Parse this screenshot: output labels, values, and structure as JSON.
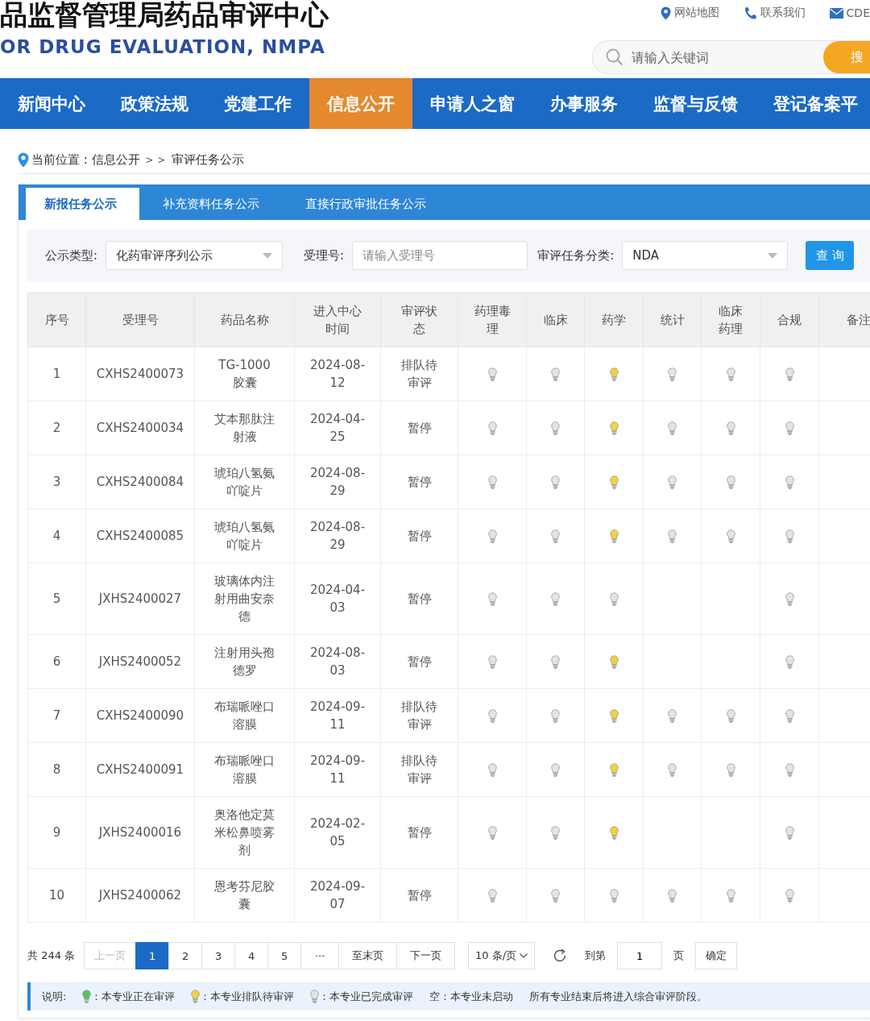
{
  "header": {
    "title": "品监督管理局药品审评中心",
    "subtitle": "OR DRUG EVALUATION, NMPA",
    "links": [
      {
        "kind": "map",
        "label": "网站地图"
      },
      {
        "kind": "phone",
        "label": "联系我们"
      },
      {
        "kind": "mail",
        "label": "CDE"
      }
    ],
    "search": {
      "placeholder": "请输入关键词",
      "button": "搜"
    }
  },
  "nav": [
    {
      "label": "新闻中心",
      "selected": false
    },
    {
      "label": "政策法规",
      "selected": false
    },
    {
      "label": "党建工作",
      "selected": false
    },
    {
      "label": "信息公开",
      "selected": true
    },
    {
      "label": "申请人之窗",
      "selected": false
    },
    {
      "label": "办事服务",
      "selected": false
    },
    {
      "label": "监督与反馈",
      "selected": false
    },
    {
      "label": "登记备案平",
      "selected": false
    }
  ],
  "breadcrumb": "当前位置 : 信息公开 ＞＞ 审评任务公示",
  "tabs": [
    {
      "label": "新报任务公示",
      "selected": true
    },
    {
      "label": "补充资料任务公示",
      "selected": false
    },
    {
      "label": "直接行政审批任务公示",
      "selected": false
    }
  ],
  "filters": {
    "type_label": "公示类型:",
    "type_value": "化药审评序列公示",
    "number_label": "受理号:",
    "number_placeholder": "请输入受理号",
    "category_label": "审评任务分类:",
    "category_value": "NDA",
    "query_button": "查 询"
  },
  "table": {
    "columns": [
      "序号",
      "受理号",
      "药品名称",
      "进入中心时间",
      "审评状态",
      "药理毒理",
      "临床",
      "药学",
      "统计",
      "临床药理",
      "合规",
      "备注"
    ],
    "rows": [
      {
        "no": "1",
        "number": "CXHS2400073",
        "name": "TG-1000胶囊",
        "date": "2024-08-12",
        "status": "排队待审评",
        "reviews": [
          {
            "kind": "done"
          },
          {
            "kind": "done"
          },
          {
            "kind": "queued"
          },
          {
            "kind": "done"
          },
          {
            "kind": "done"
          },
          {
            "kind": "done"
          }
        ]
      },
      {
        "no": "2",
        "number": "CXHS2400034",
        "name": "艾本那肽注射液",
        "date": "2024-04-25",
        "status": "暂停",
        "reviews": [
          {
            "kind": "done"
          },
          {
            "kind": "done"
          },
          {
            "kind": "queued"
          },
          {
            "kind": "done"
          },
          {
            "kind": "done"
          },
          {
            "kind": "done"
          }
        ]
      },
      {
        "no": "3",
        "number": "CXHS2400084",
        "name": "琥珀八氢氨吖啶片",
        "date": "2024-08-29",
        "status": "暂停",
        "reviews": [
          {
            "kind": "done"
          },
          {
            "kind": "done"
          },
          {
            "kind": "queued"
          },
          {
            "kind": "done"
          },
          {
            "kind": "done"
          },
          {
            "kind": "done"
          }
        ]
      },
      {
        "no": "4",
        "number": "CXHS2400085",
        "name": "琥珀八氢氨吖啶片",
        "date": "2024-08-29",
        "status": "暂停",
        "reviews": [
          {
            "kind": "done"
          },
          {
            "kind": "done"
          },
          {
            "kind": "queued"
          },
          {
            "kind": "done"
          },
          {
            "kind": "done"
          },
          {
            "kind": "done"
          }
        ]
      },
      {
        "no": "5",
        "number": "JXHS2400027",
        "name": "玻璃体内注射用曲安奈德",
        "date": "2024-04-03",
        "status": "暂停",
        "reviews": [
          {
            "kind": "done"
          },
          {
            "kind": "done"
          },
          {
            "kind": "done"
          },
          {
            "kind": "none"
          },
          {
            "kind": "none"
          },
          {
            "kind": "done"
          }
        ]
      },
      {
        "no": "6",
        "number": "JXHS2400052",
        "name": "注射用头孢德罗",
        "date": "2024-08-03",
        "status": "暂停",
        "reviews": [
          {
            "kind": "done"
          },
          {
            "kind": "done"
          },
          {
            "kind": "queued"
          },
          {
            "kind": "none"
          },
          {
            "kind": "none"
          },
          {
            "kind": "done"
          }
        ]
      },
      {
        "no": "7",
        "number": "CXHS2400090",
        "name": "布瑞哌唑口溶膜",
        "date": "2024-09-11",
        "status": "排队待审评",
        "reviews": [
          {
            "kind": "done"
          },
          {
            "kind": "done"
          },
          {
            "kind": "queued"
          },
          {
            "kind": "done"
          },
          {
            "kind": "done"
          },
          {
            "kind": "done"
          }
        ]
      },
      {
        "no": "8",
        "number": "CXHS2400091",
        "name": "布瑞哌唑口溶膜",
        "date": "2024-09-11",
        "status": "排队待审评",
        "reviews": [
          {
            "kind": "done"
          },
          {
            "kind": "done"
          },
          {
            "kind": "queued"
          },
          {
            "kind": "done"
          },
          {
            "kind": "done"
          },
          {
            "kind": "done"
          }
        ]
      },
      {
        "no": "9",
        "number": "JXHS2400016",
        "name": "奥洛他定莫米松鼻喷雾剂",
        "date": "2024-02-05",
        "status": "暂停",
        "reviews": [
          {
            "kind": "done"
          },
          {
            "kind": "done"
          },
          {
            "kind": "queued"
          },
          {
            "kind": "none"
          },
          {
            "kind": "none"
          },
          {
            "kind": "done"
          }
        ]
      },
      {
        "no": "10",
        "number": "JXHS2400062",
        "name": "恩考芬尼胶囊",
        "date": "2024-09-07",
        "status": "暂停",
        "reviews": [
          {
            "kind": "done"
          },
          {
            "kind": "done"
          },
          {
            "kind": "done"
          },
          {
            "kind": "done"
          },
          {
            "kind": "done"
          },
          {
            "kind": "done"
          }
        ]
      }
    ]
  },
  "pagination": {
    "total": "共 244 条",
    "prev": "上一页",
    "pages": [
      {
        "label": "1",
        "selected": true
      },
      {
        "label": "2",
        "selected": false
      },
      {
        "label": "3",
        "selected": false
      },
      {
        "label": "4",
        "selected": false
      },
      {
        "label": "5",
        "selected": false
      }
    ],
    "ellipsis": "···",
    "last": "至末页",
    "next": "下一页",
    "page_size": "10 条/页",
    "goto_label": "到第",
    "goto_value": "1",
    "page_unit": "页",
    "confirm": "确定"
  },
  "legend": {
    "title": "说明:",
    "items": [
      {
        "kind": "active",
        "text": "：本专业正在审评"
      },
      {
        "kind": "queued",
        "text": "：本专业排队待审评"
      },
      {
        "kind": "done",
        "text": "：本专业已完成审评"
      }
    ],
    "empty_note": "空：本专业未启动",
    "note": "所有专业结束后将进入综合审评阶段。"
  }
}
